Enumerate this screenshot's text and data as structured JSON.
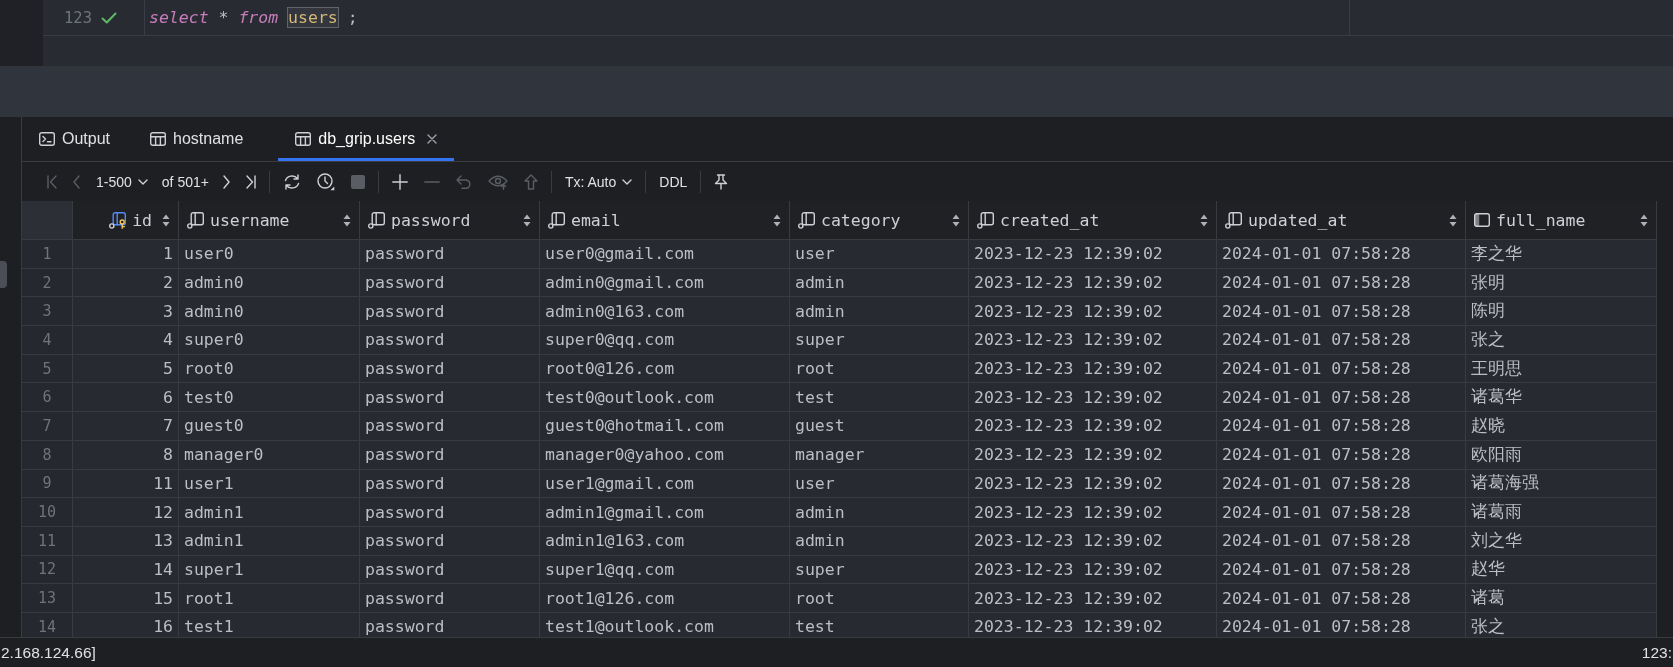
{
  "editor": {
    "lines": [
      {
        "number": "123",
        "succeeded": true,
        "tokens": [
          {
            "text": "select",
            "kind": "keyword",
            "highlighted": false
          },
          {
            "text": "*",
            "kind": "operator",
            "highlighted": false
          },
          {
            "text": "from",
            "kind": "keyword",
            "highlighted": false
          },
          {
            "text": "users",
            "kind": "identifier",
            "highlighted": true
          },
          {
            "text": ";",
            "kind": "punctuation",
            "highlighted": false
          }
        ]
      }
    ]
  },
  "results": {
    "tabs": [
      {
        "label": "Output",
        "kind": "console",
        "selected": false,
        "closable": false
      },
      {
        "label": "hostname",
        "kind": "table",
        "selected": false,
        "closable": false
      },
      {
        "label": "db_grip.users",
        "kind": "table",
        "selected": true,
        "closable": true
      }
    ],
    "toolbar": {
      "groups": [
        [
          {
            "kind": "first",
            "disabled": true
          },
          {
            "kind": "previous",
            "disabled": true
          },
          {
            "kind": "page_range",
            "label": "1-500",
            "disabled": false
          },
          {
            "kind": "row_count",
            "label": "of 501+",
            "disabled": false
          },
          {
            "kind": "next",
            "disabled": false
          },
          {
            "kind": "last",
            "disabled": false
          }
        ],
        [
          {
            "kind": "refresh",
            "disabled": false
          },
          {
            "kind": "history",
            "disabled": false
          },
          {
            "kind": "stop",
            "disabled": true
          }
        ],
        [
          {
            "kind": "add",
            "disabled": false
          },
          {
            "kind": "remove",
            "disabled": true
          },
          {
            "kind": "revert",
            "disabled": true
          },
          {
            "kind": "preview",
            "disabled": true
          },
          {
            "kind": "submit",
            "disabled": true
          }
        ],
        [
          {
            "kind": "transaction",
            "label": "Tx: Auto",
            "disabled": false
          }
        ],
        [
          {
            "kind": "ddl",
            "label": "DDL",
            "disabled": false
          }
        ],
        [
          {
            "kind": "pin",
            "disabled": false
          }
        ]
      ]
    },
    "table": {
      "columns": [
        {
          "name": "id",
          "kind": "primary_key"
        },
        {
          "name": "username",
          "kind": "not_null"
        },
        {
          "name": "password",
          "kind": "not_null"
        },
        {
          "name": "email",
          "kind": "not_null"
        },
        {
          "name": "category",
          "kind": "not_null"
        },
        {
          "name": "created_at",
          "kind": "not_null"
        },
        {
          "name": "updated_at",
          "kind": "not_null"
        },
        {
          "name": "full_name",
          "kind": "nullable"
        }
      ],
      "rows": [
        {
          "number": "1",
          "cells": [
            "1",
            "user0",
            "password",
            "user0@gmail.com",
            "user",
            "2023-12-23 12:39:02",
            "2024-01-01 07:58:28",
            "李之华"
          ]
        },
        {
          "number": "2",
          "cells": [
            "2",
            "admin0",
            "password",
            "admin0@gmail.com",
            "admin",
            "2023-12-23 12:39:02",
            "2024-01-01 07:58:28",
            "张明"
          ]
        },
        {
          "number": "3",
          "cells": [
            "3",
            "admin0",
            "password",
            "admin0@163.com",
            "admin",
            "2023-12-23 12:39:02",
            "2024-01-01 07:58:28",
            "陈明"
          ]
        },
        {
          "number": "4",
          "cells": [
            "4",
            "super0",
            "password",
            "super0@qq.com",
            "super",
            "2023-12-23 12:39:02",
            "2024-01-01 07:58:28",
            "张之"
          ]
        },
        {
          "number": "5",
          "cells": [
            "5",
            "root0",
            "password",
            "root0@126.com",
            "root",
            "2023-12-23 12:39:02",
            "2024-01-01 07:58:28",
            "王明思"
          ]
        },
        {
          "number": "6",
          "cells": [
            "6",
            "test0",
            "password",
            "test0@outlook.com",
            "test",
            "2023-12-23 12:39:02",
            "2024-01-01 07:58:28",
            "诸葛华"
          ]
        },
        {
          "number": "7",
          "cells": [
            "7",
            "guest0",
            "password",
            "guest0@hotmail.com",
            "guest",
            "2023-12-23 12:39:02",
            "2024-01-01 07:58:28",
            "赵晓"
          ]
        },
        {
          "number": "8",
          "cells": [
            "8",
            "manager0",
            "password",
            "manager0@yahoo.com",
            "manager",
            "2023-12-23 12:39:02",
            "2024-01-01 07:58:28",
            "欧阳雨"
          ]
        },
        {
          "number": "9",
          "cells": [
            "11",
            "user1",
            "password",
            "user1@gmail.com",
            "user",
            "2023-12-23 12:39:02",
            "2024-01-01 07:58:28",
            "诸葛海强"
          ]
        },
        {
          "number": "10",
          "cells": [
            "12",
            "admin1",
            "password",
            "admin1@gmail.com",
            "admin",
            "2023-12-23 12:39:02",
            "2024-01-01 07:58:28",
            "诸葛雨"
          ]
        },
        {
          "number": "11",
          "cells": [
            "13",
            "admin1",
            "password",
            "admin1@163.com",
            "admin",
            "2023-12-23 12:39:02",
            "2024-01-01 07:58:28",
            "刘之华"
          ]
        },
        {
          "number": "12",
          "cells": [
            "14",
            "super1",
            "password",
            "super1@qq.com",
            "super",
            "2023-12-23 12:39:02",
            "2024-01-01 07:58:28",
            "赵华"
          ]
        },
        {
          "number": "13",
          "cells": [
            "15",
            "root1",
            "password",
            "root1@126.com",
            "root",
            "2023-12-23 12:39:02",
            "2024-01-01 07:58:28",
            "诸葛"
          ]
        },
        {
          "number": "14",
          "cells": [
            "16",
            "test1",
            "password",
            "test1@outlook.com",
            "test",
            "2023-12-23 12:39:02",
            "2024-01-01 07:58:28",
            "张之"
          ]
        }
      ]
    }
  },
  "status_bar": {
    "left": "2.168.124.66]",
    "right": "123:"
  }
}
